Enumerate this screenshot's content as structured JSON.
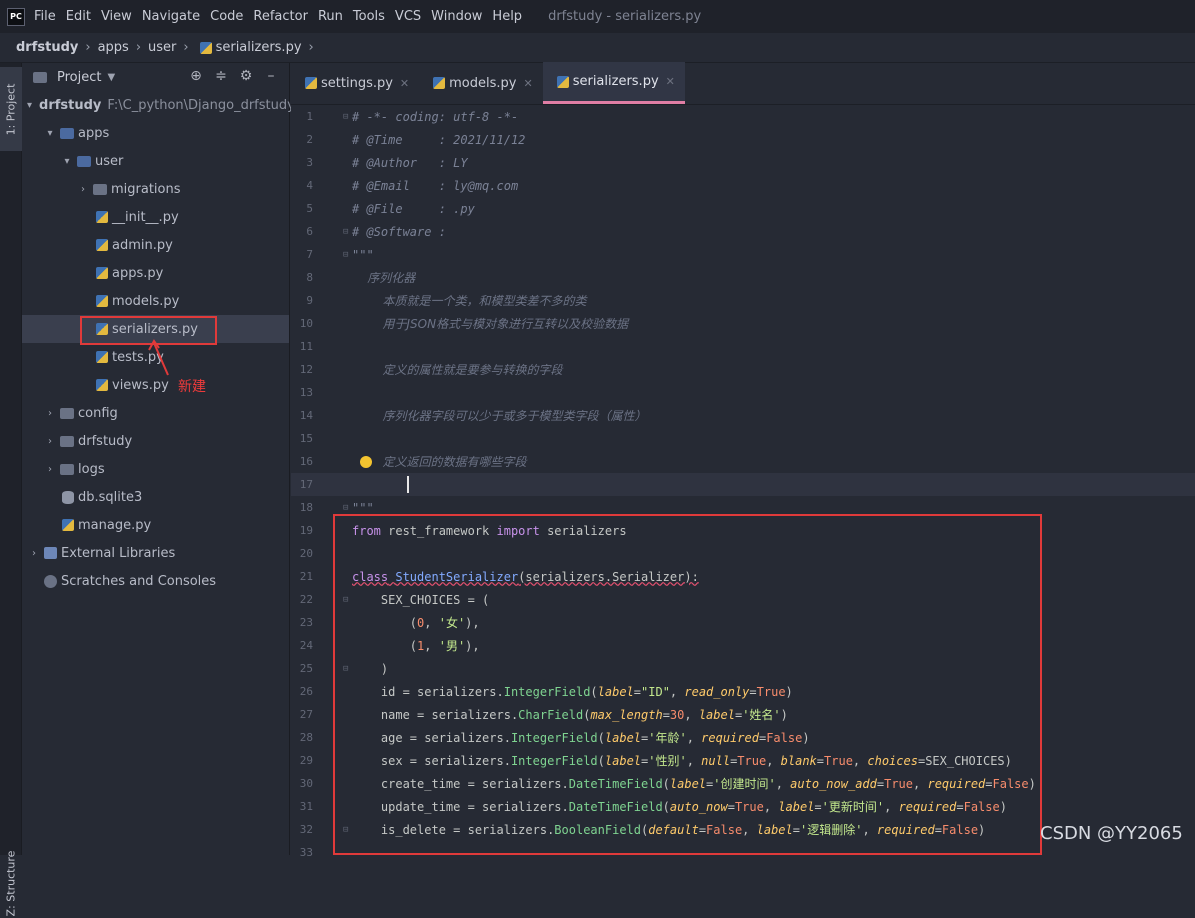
{
  "app": {
    "logo_text": "PC",
    "menu": [
      "File",
      "Edit",
      "View",
      "Navigate",
      "Code",
      "Refactor",
      "Run",
      "Tools",
      "VCS",
      "Window",
      "Help"
    ],
    "title": "drfstudy - serializers.py"
  },
  "breadcrumb": [
    "drfstudy",
    "apps",
    "user",
    "serializers.py"
  ],
  "sidebar_strip": {
    "project_tab": "1: Project",
    "structure_tab": "Z: Structure"
  },
  "project_panel": {
    "title": "Project",
    "tree": [
      {
        "label": "drfstudy",
        "path": "F:\\C_python\\Django_drfstudy\\"
      },
      {
        "label": "apps"
      },
      {
        "label": "user"
      },
      {
        "label": "migrations"
      },
      {
        "label": "__init__.py"
      },
      {
        "label": "admin.py"
      },
      {
        "label": "apps.py"
      },
      {
        "label": "models.py"
      },
      {
        "label": "serializers.py"
      },
      {
        "label": "tests.py"
      },
      {
        "label": "views.py"
      },
      {
        "label": "config"
      },
      {
        "label": "drfstudy"
      },
      {
        "label": "logs"
      },
      {
        "label": "db.sqlite3"
      },
      {
        "label": "manage.py"
      },
      {
        "label": "External Libraries"
      },
      {
        "label": "Scratches and Consoles"
      }
    ],
    "annotation": "新建"
  },
  "tabs": [
    {
      "label": "settings.py"
    },
    {
      "label": "models.py"
    },
    {
      "label": "serializers.py"
    }
  ],
  "editor": {
    "line_numbers": [
      "1",
      "2",
      "3",
      "4",
      "5",
      "6",
      "7",
      "8",
      "9",
      "10",
      "11",
      "12",
      "13",
      "14",
      "15",
      "16",
      "17",
      "18",
      "19",
      "20",
      "21",
      "22",
      "23",
      "24",
      "25",
      "26",
      "27",
      "28",
      "29",
      "30",
      "31",
      "32",
      "33"
    ],
    "comments": {
      "l1": "# -*- coding: utf-8 -*-",
      "l2": "# @Time     : 2021/11/12",
      "l3": "# @Author   : LY",
      "l4": "# @Email    : ly@mq.com",
      "l5": "# @File     : .py",
      "l6": "# @Software :",
      "l7": "\"\"\"",
      "l8": "    序列化器",
      "l9": "        本质就是一个类，和模型类差不多的类",
      "l10": "        用于JSON格式与模对象进行互转以及校验数据",
      "l12": "        定义的属性就是要参与转换的字段",
      "l14": "        序列化器字段可以少于或多于模型类字段（属性）",
      "l16": "        定义返回的数据有哪些字段",
      "l18": "\"\"\""
    },
    "code": {
      "from_kw": "from",
      "module": " rest_framework ",
      "import_kw": "import",
      "imported": " serializers",
      "class_kw": "class",
      "class_name": "StudentSerializer",
      "class_base": "(serializers.Serializer):",
      "sex_choices": "    SEX_CHOICES = (",
      "c0_open": "        (",
      "c0_num": "0",
      "c0_sep": ", ",
      "c0_str": "'女'",
      "c0_close": "),",
      "c1_open": "        (",
      "c1_num": "1",
      "c1_sep": ", ",
      "c1_str": "'男'",
      "c1_close": "),",
      "tuple_close": "    )",
      "f_id_pre": "    id = serializers.",
      "f_id_fn": "IntegerField",
      "f_id_p1": "label",
      "f_id_v1": "\"ID\"",
      "f_id_p2": "read_only",
      "f_id_v2": "True",
      "f_name_pre": "    name = serializers.",
      "f_name_fn": "CharField",
      "f_name_p1": "max_length",
      "f_name_v1": "30",
      "f_name_p2": "label",
      "f_name_v2": "'姓名'",
      "f_age_pre": "    age = serializers.",
      "f_age_fn": "IntegerField",
      "f_age_p1": "label",
      "f_age_v1": "'年龄'",
      "f_age_p2": "required",
      "f_age_v2": "False",
      "f_sex_pre": "    sex = serializers.",
      "f_sex_fn": "IntegerField",
      "f_sex_p1": "label",
      "f_sex_v1": "'性别'",
      "f_sex_p2": "null",
      "f_sex_v2": "True",
      "f_sex_p3": "blank",
      "f_sex_v3": "True",
      "f_sex_p4": "choices",
      "f_sex_v4": "SEX_CHOICES",
      "f_ct_pre": "    create_time = serializers.",
      "f_ct_fn": "DateTimeField",
      "f_ct_p1": "label",
      "f_ct_v1": "'创建时间'",
      "f_ct_p2": "auto_now_add",
      "f_ct_v2": "True",
      "f_ct_p3": "required",
      "f_ct_v3": "False",
      "f_ut_pre": "    update_time = serializers.",
      "f_ut_fn": "DateTimeField",
      "f_ut_p1": "auto_now",
      "f_ut_v1": "True",
      "f_ut_p2": "label",
      "f_ut_v2": "'更新时间'",
      "f_ut_p3": "required",
      "f_ut_v3": "False",
      "f_del_pre": "    is_delete = serializers.",
      "f_del_fn": "BooleanField",
      "f_del_p1": "default",
      "f_del_v1": "False",
      "f_del_p2": "label",
      "f_del_v2": "'逻辑删除'",
      "f_del_p3": "required",
      "f_del_v3": "False"
    }
  },
  "watermark": "CSDN @YY2065",
  "colors": {
    "accent_tab": "#e07ea5",
    "highlight_box": "#e03a3a"
  }
}
